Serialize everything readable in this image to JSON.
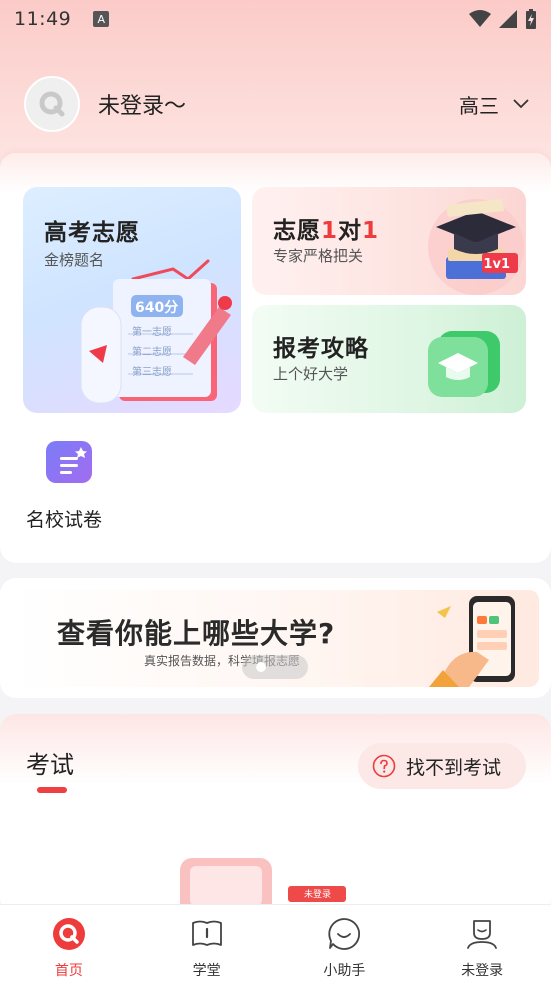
{
  "status_bar": {
    "time": "11:49",
    "notification_letter": "A"
  },
  "profile": {
    "name": "未登录～",
    "grade": "高三"
  },
  "tiles": {
    "gaokao": {
      "title": "高考志愿",
      "subtitle": "金榜题名",
      "score_badge": "640分",
      "lines": [
        "第一志愿",
        "第二志愿",
        "第三志愿"
      ]
    },
    "one_on_one": {
      "title_prefix": "志愿",
      "title_num1": "1",
      "title_mid": "对",
      "title_num2": "1",
      "subtitle": "专家严格把关",
      "badge": "1v1"
    },
    "strategy": {
      "title": "报考攻略",
      "subtitle": "上个好大学"
    }
  },
  "mingxiao": {
    "label": "名校试卷"
  },
  "banner": {
    "title": "查看你能上哪些大学?",
    "subtitle": "真实报告数据，科学填报志愿"
  },
  "exam": {
    "title": "考试",
    "cant_find": "找不到考试",
    "tag": "未登录"
  },
  "tabs": [
    {
      "label": "首页",
      "icon": "home-icon",
      "active": true
    },
    {
      "label": "学堂",
      "icon": "book-icon",
      "active": false
    },
    {
      "label": "小助手",
      "icon": "assistant-icon",
      "active": false
    },
    {
      "label": "未登录",
      "icon": "profile-icon",
      "active": false
    }
  ],
  "colors": {
    "accent": "#ee3b3b",
    "tile_blue": "#cfe4ff",
    "tile_pink": "#fde3e0",
    "tile_green": "#dff6e4"
  }
}
